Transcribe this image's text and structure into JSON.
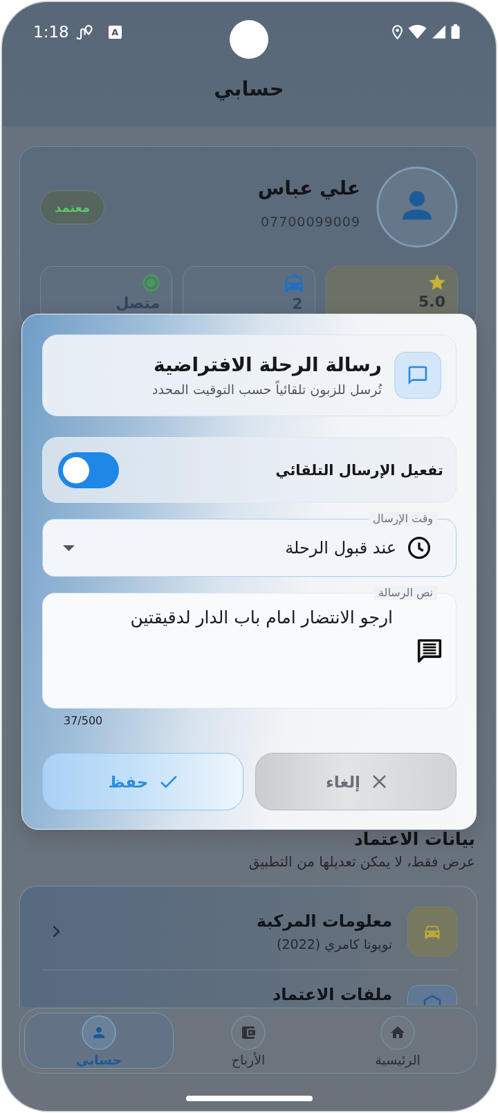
{
  "status_bar": {
    "time": "1:18",
    "notification_badge": "A"
  },
  "header": {
    "title": "حسابي"
  },
  "profile": {
    "name": "علي عباس",
    "phone": "07700099009",
    "badge": "معتمد"
  },
  "stats": [
    {
      "kind": "rating",
      "value": "5.0"
    },
    {
      "kind": "trips",
      "value": "2"
    },
    {
      "kind": "status",
      "value": "متصل"
    }
  ],
  "dialog": {
    "title": "رسالة الرحلة الافتراضية",
    "subtitle": "تُرسل للزبون تلقائياً حسب التوقيت المحدد",
    "auto_send": {
      "label": "تفعيل الإرسال التلقائي",
      "on": true
    },
    "send_time": {
      "label": "وقت الإرسال",
      "value": "عند قبول الرحلة"
    },
    "message": {
      "label": "نص الرسالة",
      "value": "ارجو الانتضار امام باب الدار لدقيقتين",
      "counter": "37/500"
    },
    "buttons": [
      {
        "kind": "cancel",
        "label": "إلغاء"
      },
      {
        "kind": "save",
        "label": "حفظ"
      }
    ]
  },
  "credentials": {
    "title": "بيانات الاعتماد",
    "subtitle": "عرض فقط، لا يمكن تعديلها من التطبيق",
    "items": [
      {
        "kind": "vehicle",
        "title": "معلومات المركبة",
        "subtitle": "تويوتا كامري (2022)"
      },
      {
        "kind": "documents",
        "title": "ملفات الاعتماد"
      }
    ]
  },
  "bottom_nav": [
    {
      "kind": "home",
      "label": "الرئيسية",
      "selected": false
    },
    {
      "kind": "earnings",
      "label": "الأرباح",
      "selected": false
    },
    {
      "kind": "account",
      "label": "حسابي",
      "selected": true
    }
  ]
}
